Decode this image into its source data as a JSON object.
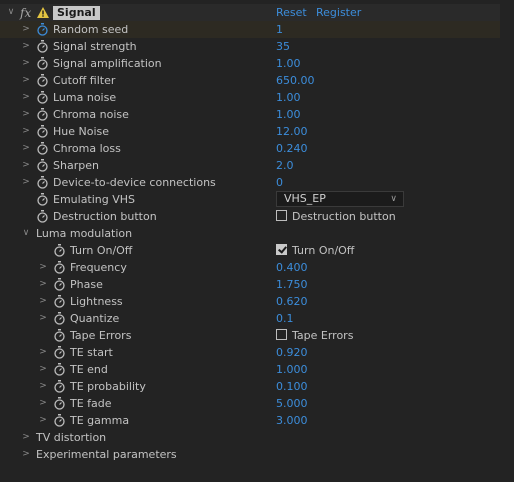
{
  "effect": {
    "name": "Signal",
    "reset_label": "Reset",
    "register_label": "Register"
  },
  "rows": [
    {
      "label": "Random seed",
      "value": "1"
    },
    {
      "label": "Signal strength",
      "value": "35"
    },
    {
      "label": "Signal amplification",
      "value": "1.00"
    },
    {
      "label": "Cutoff filter",
      "value": "650.00"
    },
    {
      "label": "Luma noise",
      "value": "1.00"
    },
    {
      "label": "Chroma noise",
      "value": "1.00"
    },
    {
      "label": "Hue Noise",
      "value": "12.00"
    },
    {
      "label": "Chroma loss",
      "value": "0.240"
    },
    {
      "label": "Sharpen",
      "value": "2.0"
    },
    {
      "label": "Device-to-device connections",
      "value": "0"
    },
    {
      "label": "Emulating VHS",
      "value": "VHS_EP"
    },
    {
      "label": "Destruction button",
      "value": "Destruction button"
    }
  ],
  "luma": {
    "group_label": "Luma modulation",
    "rows": [
      {
        "label": "Turn On/Off",
        "value": "Turn On/Off",
        "checked": true
      },
      {
        "label": "Frequency",
        "value": "0.400"
      },
      {
        "label": "Phase",
        "value": "1.750"
      },
      {
        "label": "Lightness",
        "value": "0.620"
      },
      {
        "label": "Quantize",
        "value": "0.1"
      },
      {
        "label": "Tape Errors",
        "value": "Tape Errors",
        "checked": false
      },
      {
        "label": "TE start",
        "value": "0.920"
      },
      {
        "label": "TE end",
        "value": "1.000"
      },
      {
        "label": "TE probability",
        "value": "0.100"
      },
      {
        "label": "TE fade",
        "value": "5.000"
      },
      {
        "label": "TE gamma",
        "value": "3.000"
      }
    ]
  },
  "groups": {
    "tv_distortion": "TV distortion",
    "experimental": "Experimental parameters"
  },
  "colors": {
    "value_blue": "#3c8ddb",
    "background": "#232323"
  }
}
